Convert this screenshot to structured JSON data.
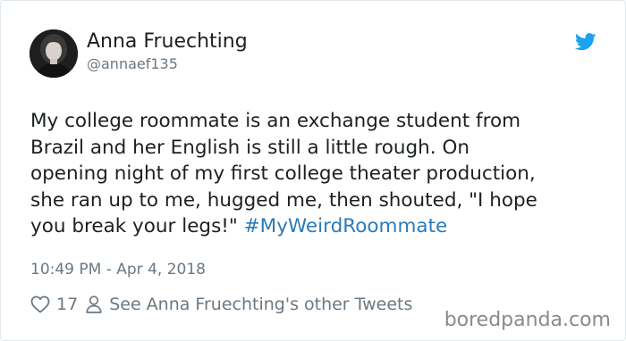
{
  "user": {
    "name": "Anna Fruechting",
    "handle": "@annaef135"
  },
  "tweet": {
    "lines": [
      "My college roommate is an exchange student from",
      "Brazil and her English is still a little rough. On",
      "opening night of my first college theater production,",
      "she ran up to me, hugged me, then shouted, \"I hope",
      "you break your legs!\" "
    ],
    "hashtag": "#MyWeirdRoommate",
    "timestamp": "10:49 PM - Apr 4, 2018"
  },
  "actions": {
    "like_count": "17",
    "profile_link": "See Anna Fruechting's other Tweets"
  },
  "watermark": "boredpanda.com",
  "icons": {
    "brand": "twitter-bird-icon",
    "like": "heart-icon",
    "profile": "person-icon"
  },
  "colors": {
    "twitter_blue": "#1da1f2",
    "hashtag": "#2b7bb9",
    "muted": "#697882",
    "text": "#1c2022"
  }
}
